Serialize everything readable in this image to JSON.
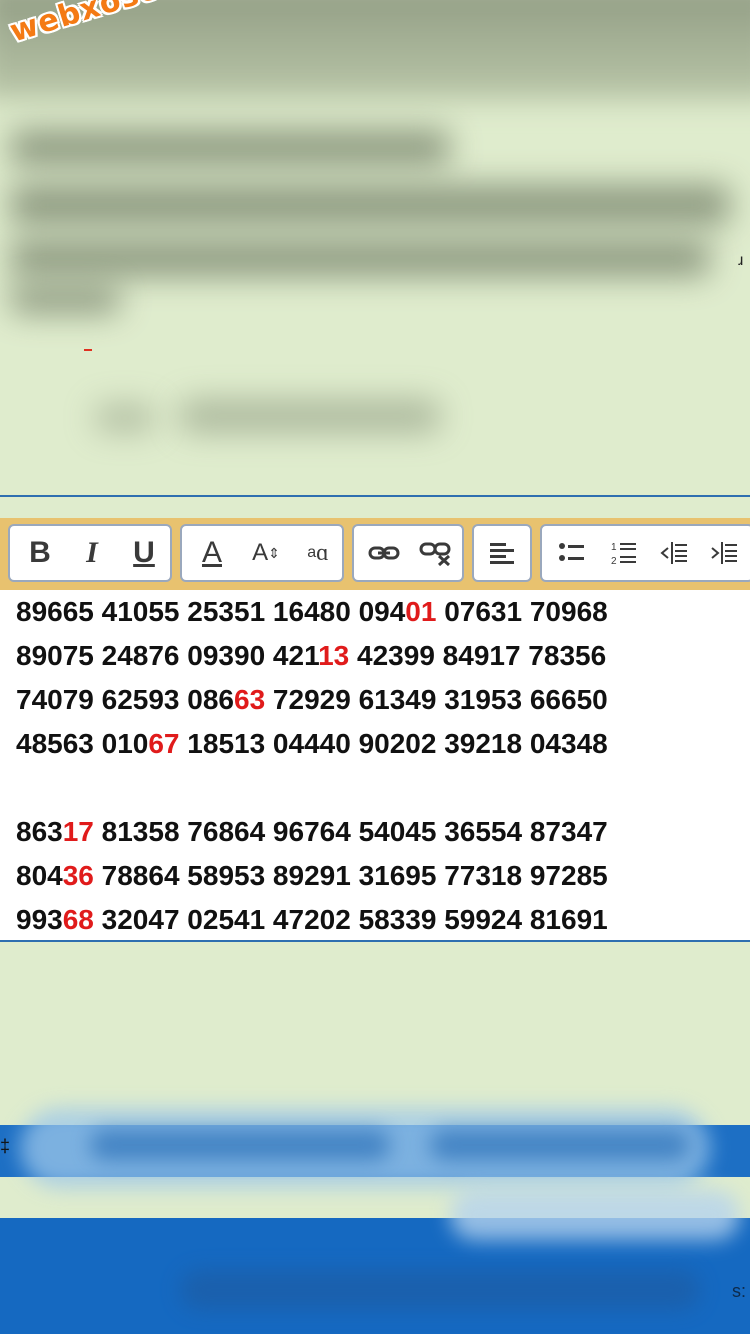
{
  "watermark": "webxoso.net",
  "toolbar": {
    "groups": [
      {
        "name": "text-style",
        "buttons": [
          {
            "name": "bold-button",
            "label": "B"
          },
          {
            "name": "italic-button",
            "label": "I"
          },
          {
            "name": "underline-button",
            "label": "U"
          }
        ]
      },
      {
        "name": "font",
        "buttons": [
          {
            "name": "font-color-button",
            "label": "A"
          },
          {
            "name": "font-size-button",
            "label": "A"
          },
          {
            "name": "font-case-button",
            "label": "a"
          }
        ]
      },
      {
        "name": "link",
        "buttons": [
          {
            "name": "insert-link-button",
            "icon": "link-icon"
          },
          {
            "name": "remove-link-button",
            "icon": "unlink-icon"
          }
        ]
      },
      {
        "name": "align",
        "buttons": [
          {
            "name": "align-left-button",
            "icon": "align-left-icon"
          }
        ]
      },
      {
        "name": "list",
        "buttons": [
          {
            "name": "bullet-list-button",
            "icon": "bullet-list-icon"
          },
          {
            "name": "numbered-list-button",
            "icon": "numbered-list-icon"
          },
          {
            "name": "outdent-button",
            "icon": "outdent-icon"
          },
          {
            "name": "indent-button",
            "icon": "indent-icon"
          }
        ]
      }
    ]
  },
  "editor": {
    "lines": [
      [
        [
          "89665 41055 25351 16480 094",
          false
        ],
        [
          "01",
          true
        ],
        [
          " 07631 70968",
          false
        ]
      ],
      [
        [
          "89075 24876 09390 421",
          false
        ],
        [
          "13",
          true
        ],
        [
          " 42399 84917 78356",
          false
        ]
      ],
      [
        [
          "74079 62593 086",
          false
        ],
        [
          "63",
          true
        ],
        [
          " 72929 61349 31953 66650",
          false
        ]
      ],
      [
        [
          "48563 010",
          false
        ],
        [
          "67",
          true
        ],
        [
          " 18513 04440 90202 39218 04348",
          false
        ]
      ],
      [],
      [
        [
          "863",
          false
        ],
        [
          "17",
          true
        ],
        [
          " 81358 76864 96764 54045 36554 87347",
          false
        ]
      ],
      [
        [
          "804",
          false
        ],
        [
          "36",
          true
        ],
        [
          " 78864 58953 89291 31695 77318 97285",
          false
        ]
      ],
      [
        [
          "993",
          false
        ],
        [
          "68",
          true
        ],
        [
          " 32047 02541 47202 58339 59924 81691",
          false
        ]
      ]
    ]
  },
  "colors": {
    "background": "#dfeccd",
    "highlight": "#e01b1b",
    "toolbar_bg": "#e8c26f",
    "accent_blue": "#1d6fc4",
    "watermark": "#f47a14"
  }
}
